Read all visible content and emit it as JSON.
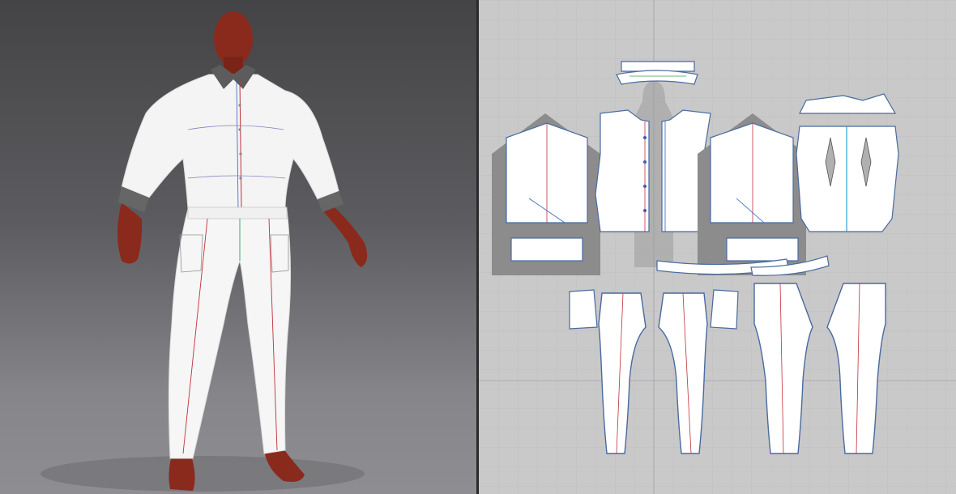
{
  "window": {
    "layout": "split-view",
    "panes": [
      "3d-garment-viewport",
      "2d-pattern-window"
    ]
  },
  "viewport_3d": {
    "background_top": "#444446",
    "background_bottom": "#8e8e92",
    "avatar": {
      "skin_color": "#8a2a1c",
      "pose": "A-pose"
    },
    "garments": [
      "shirt",
      "trousers"
    ],
    "garment_color": "#f4f4f4",
    "seam_colors": [
      "#c0303a",
      "#3060c0",
      "#30a050"
    ]
  },
  "viewport_2d": {
    "background": "#c9c9c9",
    "grid_color": "#b8b8b8",
    "axis_color": "#9a9aa8",
    "pattern_pieces": [
      "shirt-collar",
      "shirt-sleeve-left",
      "shirt-front",
      "shirt-sleeve-right",
      "shirt-back",
      "cuff-left",
      "cuff-right",
      "waistband",
      "pocket-left",
      "pants-front-left",
      "pants-front-right",
      "pocket-right",
      "pants-back-left",
      "pants-back-right"
    ],
    "piece_outline_color": "#4a6aa0",
    "piece_fill": "#ffffff",
    "sleeve_area_fill": "#8c8c8c"
  }
}
